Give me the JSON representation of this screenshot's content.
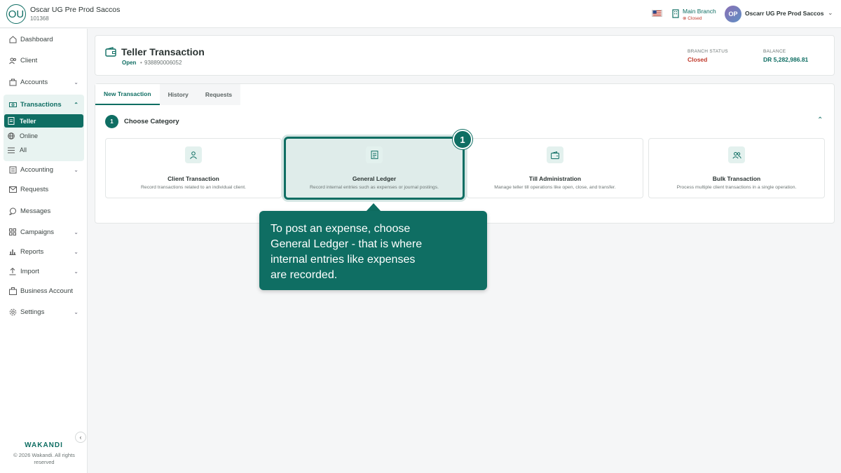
{
  "topbar": {
    "org_initials": "OU",
    "org_name": "Oscar UG Pre Prod Saccos",
    "org_id": "101368",
    "branch_name": "Main Branch",
    "branch_status": "Closed",
    "user_initials": "OP",
    "user_name": "Oscarr UG Pre Prod Saccos"
  },
  "sidebar": {
    "items": [
      {
        "label": "Dashboard",
        "icon": "home-icon"
      },
      {
        "label": "Client",
        "icon": "users-icon"
      },
      {
        "label": "Accounts",
        "icon": "briefcase-icon"
      },
      {
        "label": "Transactions",
        "icon": "banknote-icon"
      },
      {
        "label": "Accounting",
        "icon": "ledger-icon"
      },
      {
        "label": "Requests",
        "icon": "mail-icon"
      },
      {
        "label": "Messages",
        "icon": "chat-icon"
      },
      {
        "label": "Campaigns",
        "icon": "grid-icon"
      },
      {
        "label": "Reports",
        "icon": "bar-chart-icon"
      },
      {
        "label": "Import",
        "icon": "upload-icon"
      },
      {
        "label": "Business Account",
        "icon": "building-icon"
      },
      {
        "label": "Settings",
        "icon": "gear-icon"
      }
    ],
    "sub_items": [
      {
        "label": "Teller"
      },
      {
        "label": "Online"
      },
      {
        "label": "All"
      }
    ],
    "brand": "WAKANDI",
    "copyright": "© 2026 Wakandi. All rights reserved"
  },
  "header": {
    "title": "Teller Transaction",
    "status": "Open",
    "separator": "•",
    "account_no": "938890006052",
    "branch_status_label": "BRANCH STATUS",
    "branch_status_value": "Closed",
    "balance_label": "BALANCE",
    "balance_value": "DR 5,282,986.81"
  },
  "tabs": [
    {
      "label": "New Transaction"
    },
    {
      "label": "History"
    },
    {
      "label": "Requests"
    }
  ],
  "step": {
    "number": "1",
    "label": "Choose Category"
  },
  "categories": [
    {
      "title": "Client Transaction",
      "desc": "Record transactions related to an individual client."
    },
    {
      "title": "General Ledger",
      "desc": "Record internal entries such as expenses or journal postings."
    },
    {
      "title": "Till Administration",
      "desc": "Manage teller till operations like open, close, and transfer."
    },
    {
      "title": "Bulk Transaction",
      "desc": "Process multiple client transactions in a single operation."
    }
  ],
  "guide": {
    "marker": "1",
    "text": "To post an expense, choose General Ledger - that is where internal entries like expenses are recorded."
  },
  "colors": {
    "accent": "#0f6e63",
    "danger": "#c0392b"
  }
}
